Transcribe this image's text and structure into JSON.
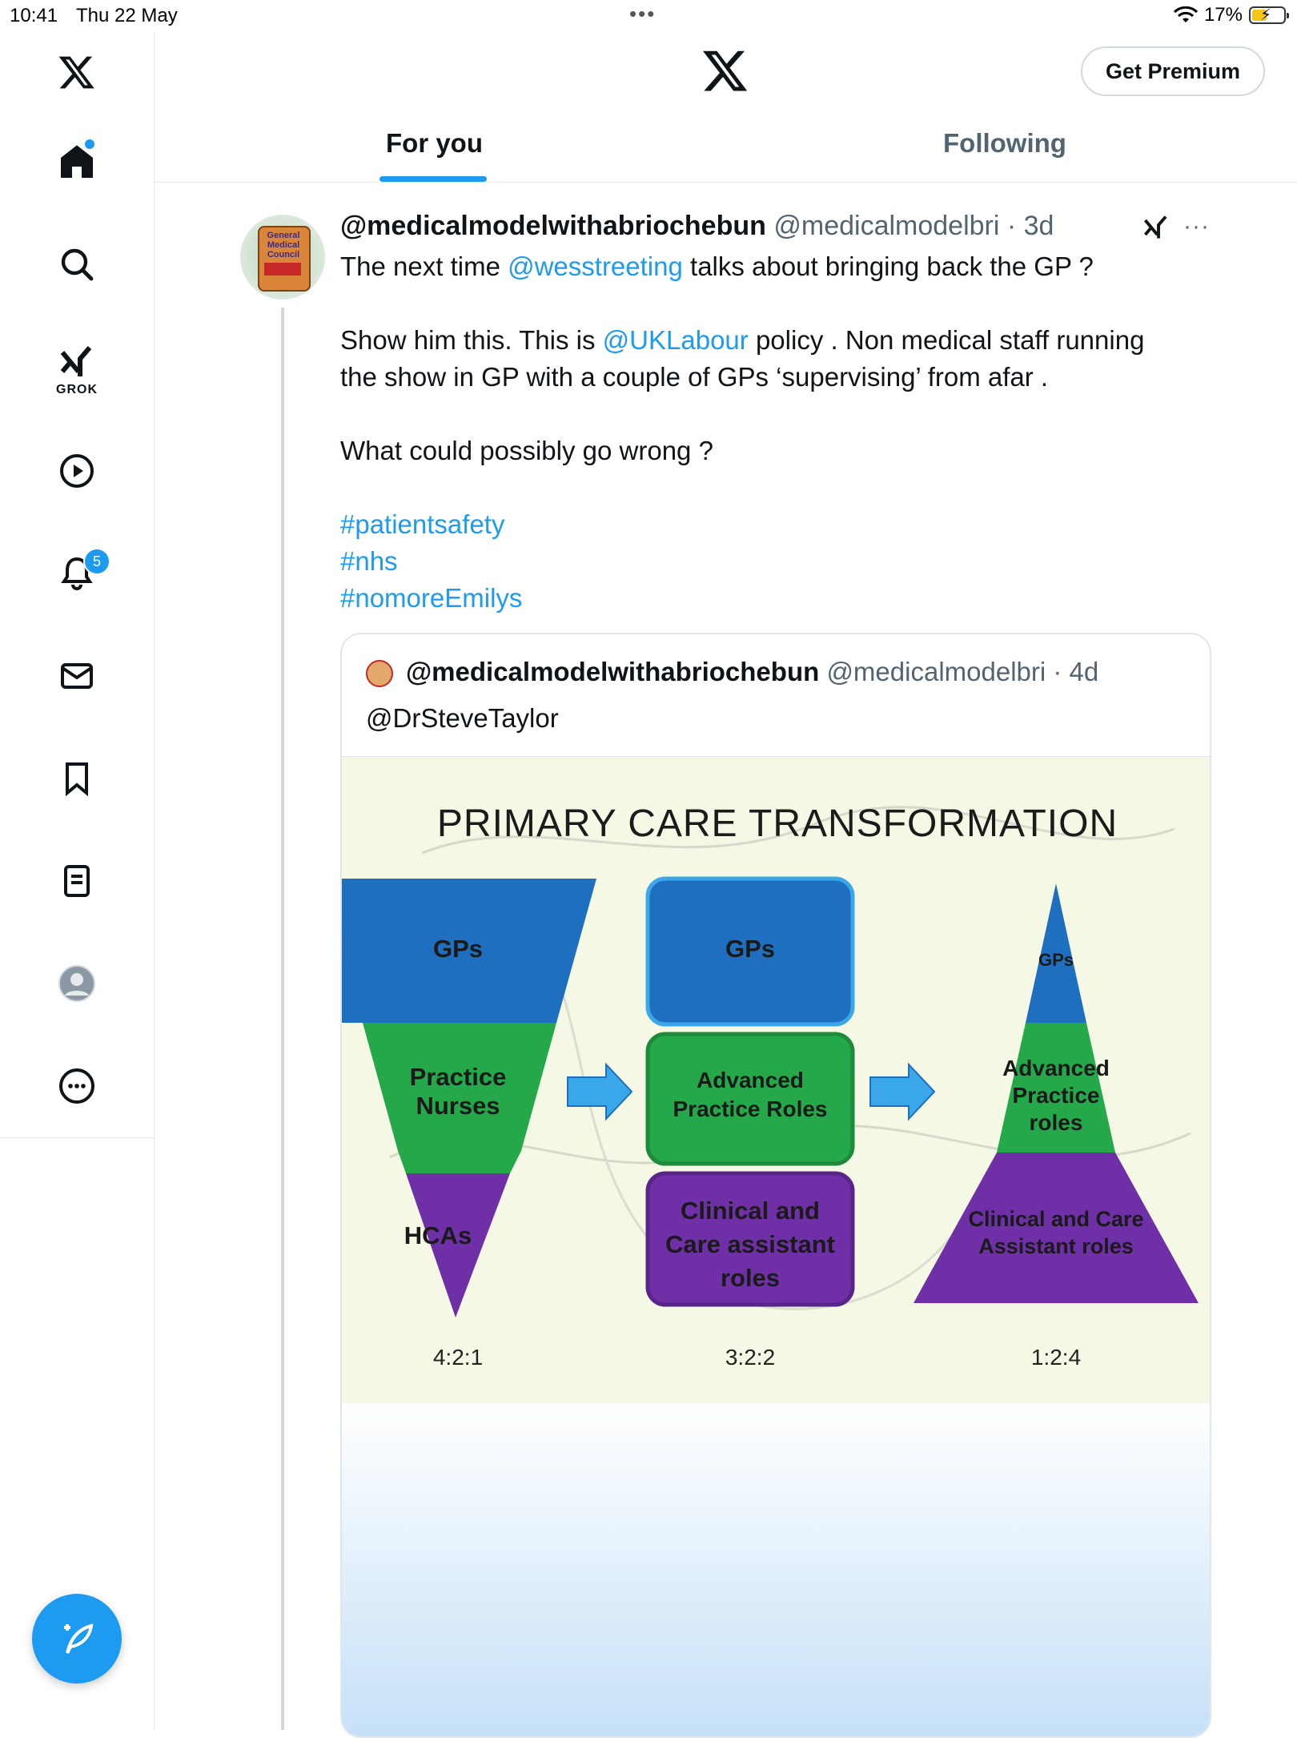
{
  "status_bar": {
    "time": "10:41",
    "date": "Thu 22 May",
    "battery_percent": "17%",
    "dots": "•••"
  },
  "sidebar": {
    "grok_label": "GROK",
    "notifications_count": "5",
    "items": [
      "home-icon",
      "search-icon",
      "grok-icon",
      "video-icon",
      "notifications-icon",
      "messages-icon",
      "bookmarks-icon",
      "lists-icon",
      "profile-icon",
      "more-icon"
    ]
  },
  "header": {
    "premium_label": "Get Premium",
    "tabs": [
      {
        "label": "For you",
        "active": true
      },
      {
        "label": "Following",
        "active": false
      }
    ]
  },
  "tweet": {
    "display_name": "@medicalmodelwithabriochebun",
    "handle": "@medicalmodelbri",
    "sep": " · ",
    "time": "3d",
    "line1_a": "The next time ",
    "mention1": "@wesstreeting",
    "line1_b": "  talks about bringing back the GP ?",
    "line2_a": "Show him this. This is ",
    "mention2": "@UKLabour",
    "line2_b": " policy . Non medical staff running",
    "line3": "the show in GP with a couple of GPs ‘supervising’ from afar .",
    "line4": "What could possibly go wrong ?",
    "hashtags": [
      "#patientsafety",
      "#nhs",
      "#nomoreEmilys"
    ],
    "avatar_text": "General Medical Council"
  },
  "quote": {
    "display_name": "@medicalmodelwithabriochebun",
    "handle": "@medicalmodelbri",
    "sep": " · ",
    "time": "4d",
    "text": "@DrSteveTaylor"
  },
  "diagram": {
    "title": "PRIMARY CARE TRANSFORMATION",
    "left": {
      "top": "GPs",
      "middle": "Practice\nNurses",
      "bottom": "HCAs",
      "ratio": "4:2:1"
    },
    "center": {
      "top": "GPs",
      "middle": "Advanced\nPractice Roles",
      "bottom": "Clinical and\nCare assistant\nroles",
      "ratio": "3:2:2"
    },
    "right": {
      "top": "GPs",
      "middle": "Advanced\nPractice\nroles",
      "bottom": "Clinical and Care\nAssistant roles",
      "ratio": "1:2:4"
    },
    "colors": {
      "blue": "#1f6fc0",
      "green": "#25a84a",
      "purple": "#6f2fa6",
      "arrow": "#3aa8e8"
    }
  },
  "compose_icon": "compose-icon"
}
